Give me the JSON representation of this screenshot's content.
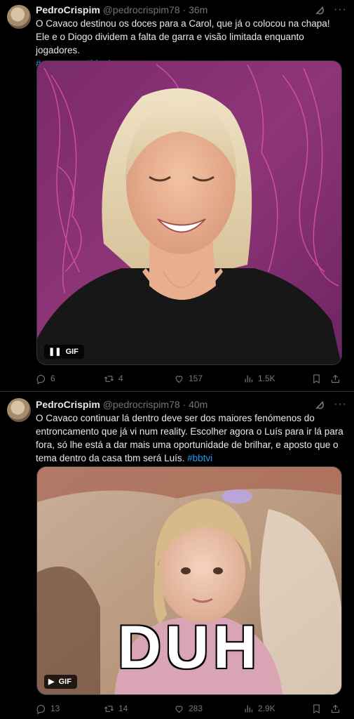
{
  "tweets": [
    {
      "author_name": "PedroCrispim",
      "handle_time": "@pedrocrispim78 · 36m",
      "text_main": "O Cavaco destinou os doces para a Carol, que já o colocou na chapa! Ele e o Diogo dividem a falta de garra e visão limitada enquanto jogadores.",
      "hashtags": "#soquenao #bbtvi",
      "gif_label": "GIF",
      "replies": "6",
      "reposts": "4",
      "likes": "157",
      "views": "1.5K"
    },
    {
      "author_name": "PedroCrispim",
      "handle_time": "@pedrocrispim78 · 40m",
      "text_main": "O Cavaco continuar lá dentro deve ser dos maiores fenómenos do entroncamento que já vi num reality. Escolher agora o Luís para ir lá para fora, só lhe está a dar mais uma  oportunidade de brilhar, e aposto que o tema dentro da casa tbm será Luís.",
      "hashtags": "#bbtvi",
      "gif_label": "GIF",
      "gif_caption": "DUH",
      "replies": "13",
      "reposts": "14",
      "likes": "283",
      "views": "2.9K"
    }
  ],
  "colors": {
    "accent": "#1d9bf0",
    "muted": "#71767b",
    "text": "#e7e9ea",
    "background": "#000000"
  }
}
